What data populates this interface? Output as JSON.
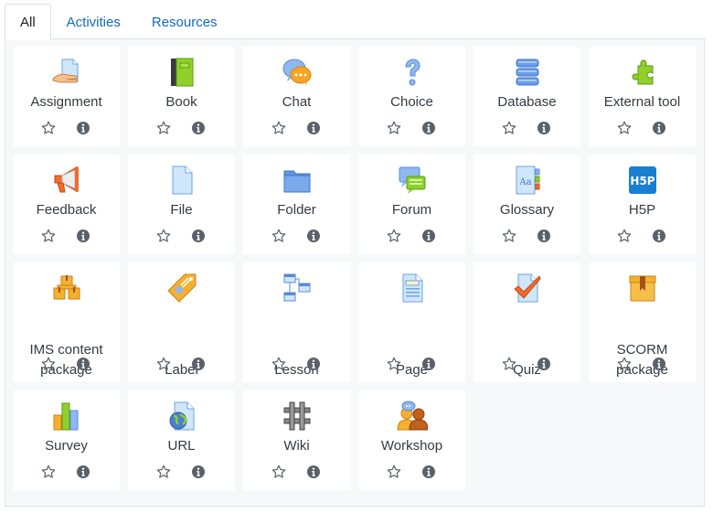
{
  "tabs": [
    {
      "label": "All",
      "active": true
    },
    {
      "label": "Activities",
      "active": false
    },
    {
      "label": "Resources",
      "active": false
    }
  ],
  "colors": {
    "link": "#0f6cbf",
    "panel_bg": "#f7f8fa",
    "border": "#dee2e6",
    "action_icon": "#5a6169"
  },
  "modules": [
    {
      "label": "Assignment",
      "icon": "assignment-icon"
    },
    {
      "label": "Book",
      "icon": "book-icon"
    },
    {
      "label": "Chat",
      "icon": "chat-icon"
    },
    {
      "label": "Choice",
      "icon": "choice-icon"
    },
    {
      "label": "Database",
      "icon": "database-icon"
    },
    {
      "label": "External tool",
      "icon": "external-tool-icon"
    },
    {
      "label": "Feedback",
      "icon": "feedback-icon"
    },
    {
      "label": "File",
      "icon": "file-icon"
    },
    {
      "label": "Folder",
      "icon": "folder-icon"
    },
    {
      "label": "Forum",
      "icon": "forum-icon"
    },
    {
      "label": "Glossary",
      "icon": "glossary-icon"
    },
    {
      "label": "H5P",
      "icon": "h5p-icon"
    },
    {
      "label": "IMS content package",
      "icon": "ims-content-package-icon"
    },
    {
      "label": "Label",
      "icon": "label-icon"
    },
    {
      "label": "Lesson",
      "icon": "lesson-icon"
    },
    {
      "label": "Page",
      "icon": "page-icon"
    },
    {
      "label": "Quiz",
      "icon": "quiz-icon"
    },
    {
      "label": "SCORM package",
      "icon": "scorm-package-icon"
    },
    {
      "label": "Survey",
      "icon": "survey-icon"
    },
    {
      "label": "URL",
      "icon": "url-icon"
    },
    {
      "label": "Wiki",
      "icon": "wiki-icon"
    },
    {
      "label": "Workshop",
      "icon": "workshop-icon"
    }
  ],
  "action_icons": {
    "star": "star-outline-icon",
    "info": "info-icon"
  },
  "h5p_text": "H5P",
  "glossary_text": "Aa"
}
